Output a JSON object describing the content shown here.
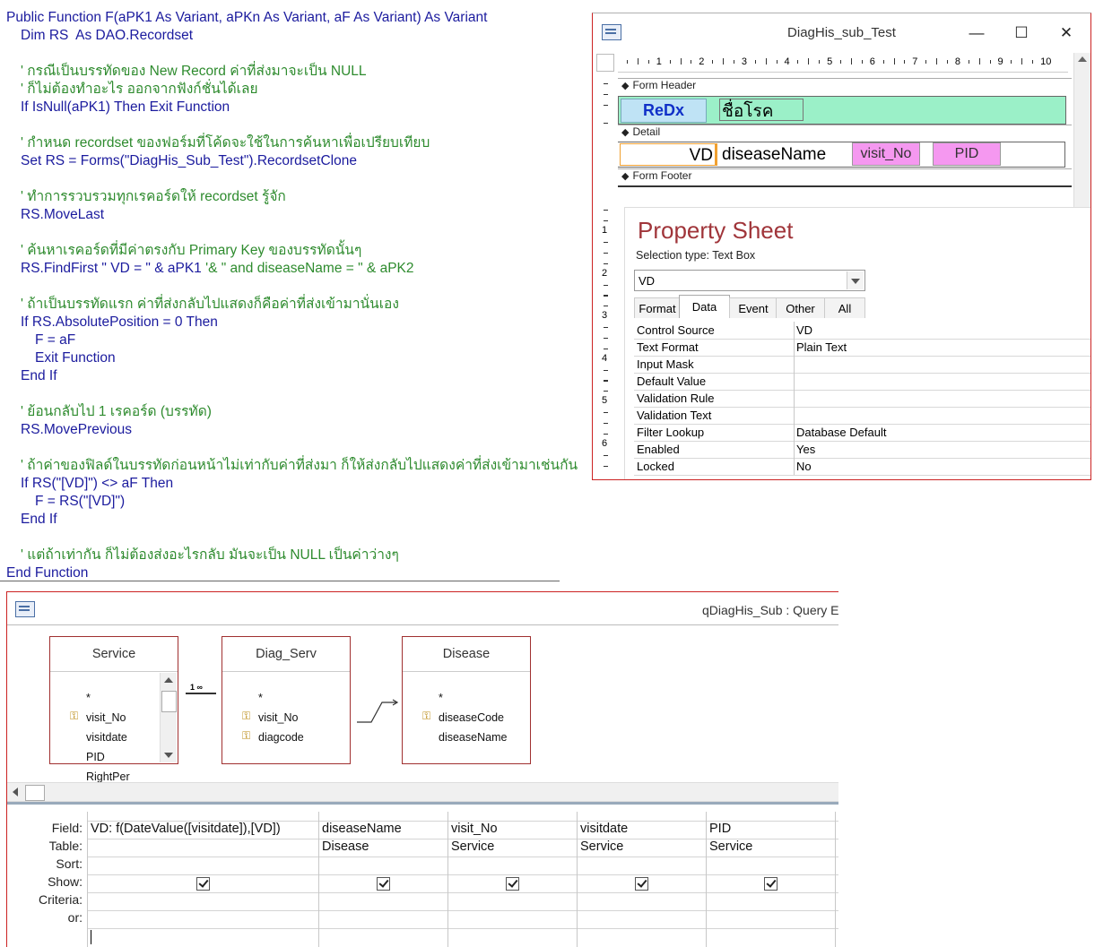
{
  "code": {
    "lines": [
      {
        "text": "Public Function F(aPK1 As Variant, aPKn As Variant, aF As Variant) As Variant",
        "type": "kw",
        "indent": 0
      },
      {
        "text": "Dim RS  As DAO.Recordset",
        "type": "kw",
        "indent": 1
      },
      {
        "text": "",
        "type": "kw",
        "indent": 0
      },
      {
        "text": "' กรณีเป็นบรรทัดของ New Record ค่าที่ส่งมาจะเป็น NULL",
        "type": "cm",
        "indent": 1
      },
      {
        "text": "' ก็ไม่ต้องทำอะไร ออกจากฟังก์ชั่นได้เลย",
        "type": "cm",
        "indent": 1
      },
      {
        "text": "If IsNull(aPK1) Then Exit Function",
        "type": "kw",
        "indent": 1
      },
      {
        "text": "",
        "type": "kw",
        "indent": 0
      },
      {
        "text": "' กำหนด recordset ของฟอร์มที่โค้ดจะใช้ในการค้นหาเพื่อเปรียบเทียบ",
        "type": "cm",
        "indent": 1
      },
      {
        "text": "Set RS = Forms(\"DiagHis_Sub_Test\").RecordsetClone",
        "type": "kw",
        "indent": 1
      },
      {
        "text": "",
        "type": "kw",
        "indent": 0
      },
      {
        "text": "' ทำการรวบรวมทุกเรคอร์ดให้ recordset รู้จัก",
        "type": "cm",
        "indent": 1
      },
      {
        "text": "RS.MoveLast",
        "type": "kw",
        "indent": 1
      },
      {
        "text": "",
        "type": "kw",
        "indent": 0
      },
      {
        "text": "' ค้นหาเรคอร์ดที่มีค่าตรงกับ Primary Key ของบรรทัดนั้นๆ",
        "type": "cm",
        "indent": 1
      },
      {
        "text": "RS.FindFirst \" VD = \" & aPK1 '& \" and diseaseName = \" & aPK2",
        "type": "mix",
        "indent": 1
      },
      {
        "text": "",
        "type": "kw",
        "indent": 0
      },
      {
        "text": "' ถ้าเป็นบรรทัดแรก ค่าที่ส่งกลับไปแสดงก็คือค่าที่ส่งเข้ามานั่นเอง",
        "type": "cm",
        "indent": 1
      },
      {
        "text": "If RS.AbsolutePosition = 0 Then",
        "type": "kw",
        "indent": 1
      },
      {
        "text": "F = aF",
        "type": "kw",
        "indent": 2
      },
      {
        "text": "Exit Function",
        "type": "kw",
        "indent": 2
      },
      {
        "text": "End If",
        "type": "kw",
        "indent": 1
      },
      {
        "text": "",
        "type": "kw",
        "indent": 0
      },
      {
        "text": "' ย้อนกลับไป 1 เรคอร์ด (บรรทัด)",
        "type": "cm",
        "indent": 1
      },
      {
        "text": "RS.MovePrevious",
        "type": "kw",
        "indent": 1
      },
      {
        "text": "",
        "type": "kw",
        "indent": 0
      },
      {
        "text": "' ถ้าค่าของฟิลด์ในบรรทัดก่อนหน้าไม่เท่ากับค่าที่ส่งมา ก็ให้ส่งกลับไปแสดงค่าที่ส่งเข้ามาเช่นกัน",
        "type": "cm",
        "indent": 1
      },
      {
        "text": "If RS(\"[VD]\") <> aF Then",
        "type": "kw",
        "indent": 1
      },
      {
        "text": "F = RS(\"[VD]\")",
        "type": "kw",
        "indent": 2
      },
      {
        "text": "End If",
        "type": "kw",
        "indent": 1
      },
      {
        "text": "",
        "type": "kw",
        "indent": 0
      },
      {
        "text": "' แต่ถ้าเท่ากัน ก็ไม่ต้องส่งอะไรกลับ มันจะเป็น NULL เป็นค่าว่างๆ",
        "type": "cm",
        "indent": 1
      },
      {
        "text": "End Function",
        "type": "kw",
        "indent": 0
      }
    ],
    "findfirst_code": "RS.FindFirst \" VD = \" & aPK1 ",
    "findfirst_comment": "'& \" and diseaseName = \" & aPK2"
  },
  "form_window": {
    "title": "DiagHis_sub_Test",
    "minimize": "—",
    "maximize": "☐",
    "close": "✕",
    "ruler_numbers": [
      "1",
      "2",
      "3",
      "4",
      "5",
      "6",
      "7",
      "8",
      "9",
      "10"
    ],
    "vruler_numbers": [
      "1",
      "2",
      "3",
      "4",
      "5",
      "6"
    ],
    "sections": {
      "header": "Form Header",
      "detail": "Detail",
      "footer": "Form Footer"
    },
    "header_labels": {
      "redx": "ReDx",
      "thai": "ชื่อโรค"
    },
    "detail_fields": {
      "vd": "VD",
      "disease": "diseaseName",
      "visit_no": "visit_No",
      "pid": "PID"
    }
  },
  "property_sheet": {
    "title": "Property Sheet",
    "selection_type": "Selection type:  Text Box",
    "selected": "VD",
    "tabs": [
      "Format",
      "Data",
      "Event",
      "Other",
      "All"
    ],
    "active_tab": "Data",
    "rows": [
      {
        "k": "Control Source",
        "v": "VD"
      },
      {
        "k": "Text Format",
        "v": "Plain Text"
      },
      {
        "k": "Input Mask",
        "v": ""
      },
      {
        "k": "Default Value",
        "v": ""
      },
      {
        "k": "Validation Rule",
        "v": ""
      },
      {
        "k": "Validation Text",
        "v": ""
      },
      {
        "k": "Filter Lookup",
        "v": "Database Default"
      },
      {
        "k": "Enabled",
        "v": "Yes"
      },
      {
        "k": "Locked",
        "v": "No"
      }
    ]
  },
  "query_window": {
    "title": "qDiagHis_Sub : Query E",
    "tables": [
      {
        "name": "Service",
        "fields": [
          {
            "n": "*",
            "key": false
          },
          {
            "n": "visit_No",
            "key": true
          },
          {
            "n": "visitdate",
            "key": false
          },
          {
            "n": "PID",
            "key": false
          },
          {
            "n": "RightPer",
            "key": false
          }
        ]
      },
      {
        "name": "Diag_Serv",
        "fields": [
          {
            "n": "*",
            "key": false
          },
          {
            "n": "visit_No",
            "key": true
          },
          {
            "n": "diagcode",
            "key": true
          }
        ]
      },
      {
        "name": "Disease",
        "fields": [
          {
            "n": "*",
            "key": false
          },
          {
            "n": "diseaseCode",
            "key": true
          },
          {
            "n": "diseaseName",
            "key": false
          }
        ]
      }
    ],
    "relation_label": "1 ∞",
    "row_labels": [
      "Field:",
      "Table:",
      "Sort:",
      "Show:",
      "Criteria:",
      "or:"
    ],
    "columns": [
      {
        "field": "VD: f(DateValue([visitdate]),[VD])",
        "table": "",
        "show": true
      },
      {
        "field": "diseaseName",
        "table": "Disease",
        "show": true
      },
      {
        "field": "visit_No",
        "table": "Service",
        "show": true
      },
      {
        "field": "visitdate",
        "table": "Service",
        "show": true
      },
      {
        "field": "PID",
        "table": "Service",
        "show": true
      }
    ]
  }
}
